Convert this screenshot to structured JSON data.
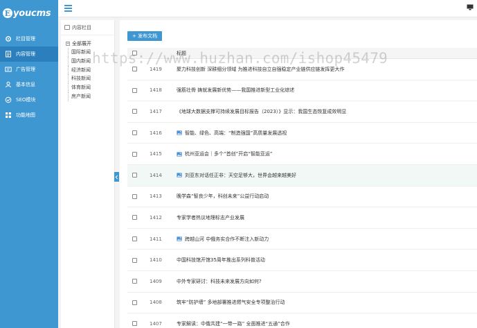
{
  "brand": {
    "mark": "E",
    "name": "youcms",
    "accent": "#3f97d2"
  },
  "sidebar": {
    "items": [
      {
        "label": "栏目管理",
        "icon": "gear-icon",
        "active": false
      },
      {
        "label": "内容管理",
        "icon": "document-icon",
        "active": true
      },
      {
        "label": "广告管理",
        "icon": "ad-icon",
        "active": false
      },
      {
        "label": "基本信息",
        "icon": "user-icon",
        "active": false
      },
      {
        "label": "SEO模块",
        "icon": "seo-icon",
        "active": false
      },
      {
        "label": "功能地图",
        "icon": "map-icon",
        "active": false
      }
    ]
  },
  "tree": {
    "title": "内容栏目",
    "expand_all": "全部展开",
    "items": [
      "国际新闻",
      "国内新闻",
      "经济新闻",
      "科技新闻",
      "体育新闻",
      "房产新闻"
    ]
  },
  "toolbar": {
    "add_label": "+ 发布文档"
  },
  "table": {
    "header": {
      "title": "标题"
    },
    "rows": [
      {
        "id": "1419",
        "title": "聚力科技创新 深耕细分领域 为推进科技自立自强稳定产业链供应链发挥更大作",
        "image": false
      },
      {
        "id": "1418",
        "title": "强筋壮骨 铸就发展新优势——我国推进新型工业化综述",
        "image": false
      },
      {
        "id": "1417",
        "title": "《地球大数据支撑可持续发展目标报告（2023）》显示：我国生态恢复成效明显",
        "image": false
      },
      {
        "id": "1416",
        "title": "智能、绿色、高端：“制造强国”高质量发展透视",
        "image": true
      },
      {
        "id": "1415",
        "title": "杭州亚运会｜多个“首创”开启“智能亚运”",
        "image": true
      },
      {
        "id": "1414",
        "title": "刘亚东对话任正非：天空足够大，世界会越来越美好",
        "image": true
      },
      {
        "id": "1413",
        "title": "晚学森“智良少年，科创未来”公益行动启动",
        "image": false
      },
      {
        "id": "1412",
        "title": "专家学者热议地理标志产业发展",
        "image": false
      },
      {
        "id": "1411",
        "title": "跨越山河 中俄务实合作不断注入新动力",
        "image": true
      },
      {
        "id": "1410",
        "title": "中国科技馆开馆35周年推出系列科普活动",
        "image": false
      },
      {
        "id": "1409",
        "title": "中外专家研讨：科技未来发展方向如何?",
        "image": false
      },
      {
        "id": "1408",
        "title": "筑牢“防护墙” 多地部署推进燃气安全专项整治行动",
        "image": false
      },
      {
        "id": "1407",
        "title": "专家解读：中俄共建“一带一路” 全面推进“五通”合作",
        "image": false
      }
    ]
  },
  "watermark": "https://www.huzhan.com/ishop45479"
}
